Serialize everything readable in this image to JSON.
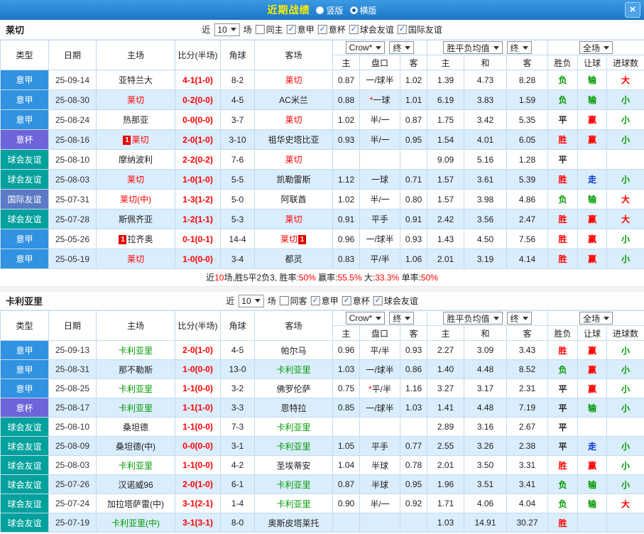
{
  "titlebar": {
    "title": "近期战绩",
    "radio_vertical": "竖版",
    "radio_horizontal": "横版",
    "close": "×"
  },
  "type_colors": {
    "意甲": "#3092e0",
    "意杯": "#6e64d9",
    "球会友谊": "#00a19d",
    "国际友谊": "#5b7ac5"
  },
  "status_colors": {
    "r": "#ff0000",
    "g": "#009900",
    "b": "#0033cc",
    "k": "#222222"
  },
  "sections": [
    {
      "team": "莱切",
      "team_color": "#ff0000",
      "filters": {
        "near_label": "近",
        "count": "10",
        "games_label": "场",
        "checkboxes": [
          {
            "label": "同主",
            "checked": false
          },
          {
            "label": "意甲",
            "checked": true
          },
          {
            "label": "意杯",
            "checked": true
          },
          {
            "label": "球会友谊",
            "checked": true
          },
          {
            "label": "国际友谊",
            "checked": true
          }
        ]
      },
      "header": {
        "type": "类型",
        "date": "日期",
        "home": "主场",
        "score": "比分(半场)",
        "corner": "角球",
        "away": "客场",
        "odds_select": "Crow*",
        "odds_final": "终",
        "avg_select": "胜平负均值",
        "avg_final": "终",
        "scope_select": "全场",
        "sub": [
          "主",
          "盘口",
          "客",
          "主",
          "和",
          "客",
          "胜负",
          "让球",
          "进球数"
        ]
      },
      "rows": [
        {
          "type": "意甲",
          "date": "25-09-14",
          "home": "亚特兰大",
          "score": "4-1(1-0)",
          "corner": "8-2",
          "away": "莱切",
          "away_hl": true,
          "odds": [
            "0.87",
            "一/球半",
            "1.02"
          ],
          "avg": [
            "1.39",
            "4.73",
            "8.28"
          ],
          "res": "负",
          "res_c": "g",
          "han": "输",
          "han_c": "g",
          "goal": "大",
          "goal_c": "r"
        },
        {
          "type": "意甲",
          "date": "25-08-30",
          "home": "莱切",
          "home_hl": true,
          "score": "0-2(0-0)",
          "corner": "4-5",
          "away": "AC米兰",
          "odds": [
            "0.88",
            "*一球",
            "1.01"
          ],
          "avg": [
            "6.19",
            "3.83",
            "1.59"
          ],
          "res": "负",
          "res_c": "g",
          "han": "输",
          "han_c": "g",
          "goal": "小",
          "goal_c": "g"
        },
        {
          "type": "意甲",
          "date": "25-08-24",
          "home": "热那亚",
          "score": "0-0(0-0)",
          "corner": "3-7",
          "away": "莱切",
          "away_hl": true,
          "odds": [
            "1.02",
            "半/一",
            "0.87"
          ],
          "avg": [
            "1.75",
            "3.42",
            "5.35"
          ],
          "res": "平",
          "res_c": "k",
          "han": "赢",
          "han_c": "r",
          "goal": "小",
          "goal_c": "g"
        },
        {
          "type": "意杯",
          "date": "25-08-16",
          "home": "莱切",
          "home_hl": true,
          "home_badge": "1",
          "score": "2-0(1-0)",
          "corner": "3-10",
          "away": "祖华史塔比亚",
          "odds": [
            "0.93",
            "半/一",
            "0.95"
          ],
          "avg": [
            "1.54",
            "4.01",
            "6.05"
          ],
          "res": "胜",
          "res_c": "r",
          "han": "赢",
          "han_c": "r",
          "goal": "小",
          "goal_c": "g"
        },
        {
          "type": "球会友谊",
          "date": "25-08-10",
          "home": "摩纳波利",
          "score": "2-2(0-2)",
          "corner": "7-6",
          "away": "莱切",
          "away_hl": true,
          "odds": [
            "",
            "",
            ""
          ],
          "avg": [
            "9.09",
            "5.16",
            "1.28"
          ],
          "res": "平",
          "res_c": "k",
          "han": "",
          "goal": ""
        },
        {
          "type": "球会友谊",
          "date": "25-08-03",
          "home": "莱切",
          "home_hl": true,
          "score": "1-0(1-0)",
          "corner": "5-5",
          "away": "凯勒雷斯",
          "odds": [
            "1.12",
            "一球",
            "0.71"
          ],
          "avg": [
            "1.57",
            "3.61",
            "5.39"
          ],
          "res": "胜",
          "res_c": "r",
          "han": "走",
          "han_c": "b",
          "goal": "小",
          "goal_c": "g"
        },
        {
          "type": "国际友谊",
          "date": "25-07-31",
          "home": "莱切(中)",
          "home_hl": true,
          "score": "1-3(1-2)",
          "corner": "5-0",
          "away": "阿联酋",
          "odds": [
            "1.02",
            "半/一",
            "0.80"
          ],
          "avg": [
            "1.57",
            "3.98",
            "4.86"
          ],
          "res": "负",
          "res_c": "g",
          "han": "输",
          "han_c": "g",
          "goal": "大",
          "goal_c": "r"
        },
        {
          "type": "球会友谊",
          "date": "25-07-28",
          "home": "斯佩齐亚",
          "score": "1-2(1-1)",
          "corner": "5-3",
          "away": "莱切",
          "away_hl": true,
          "odds": [
            "0.91",
            "平手",
            "0.91"
          ],
          "avg": [
            "2.42",
            "3.56",
            "2.47"
          ],
          "res": "胜",
          "res_c": "r",
          "han": "赢",
          "han_c": "r",
          "goal": "大",
          "goal_c": "r"
        },
        {
          "type": "意甲",
          "date": "25-05-26",
          "home": "拉齐奥",
          "home_badge": "1",
          "score": "0-1(0-1)",
          "corner": "14-4",
          "away": "莱切",
          "away_hl": true,
          "away_badge": "1",
          "odds": [
            "0.96",
            "一/球半",
            "0.93"
          ],
          "avg": [
            "1.43",
            "4.50",
            "7.56"
          ],
          "res": "胜",
          "res_c": "r",
          "han": "赢",
          "han_c": "r",
          "goal": "小",
          "goal_c": "g"
        },
        {
          "type": "意甲",
          "date": "25-05-19",
          "home": "莱切",
          "home_hl": true,
          "score": "1-0(0-0)",
          "corner": "3-4",
          "away": "都灵",
          "odds": [
            "0.83",
            "平/半",
            "1.06"
          ],
          "avg": [
            "2.01",
            "3.19",
            "4.14"
          ],
          "res": "胜",
          "res_c": "r",
          "han": "赢",
          "han_c": "r",
          "goal": "小",
          "goal_c": "g"
        }
      ],
      "summary": [
        {
          "t": "近",
          "c": "k"
        },
        {
          "t": "10",
          "c": "r"
        },
        {
          "t": "场,胜5平2负3, 胜率:",
          "c": "k"
        },
        {
          "t": "50%",
          "c": "r"
        },
        {
          "t": " 赢率:",
          "c": "k"
        },
        {
          "t": "55.5%",
          "c": "r"
        },
        {
          "t": " 大:",
          "c": "k"
        },
        {
          "t": "33.3%",
          "c": "r"
        },
        {
          "t": " 单率:",
          "c": "k"
        },
        {
          "t": "50%",
          "c": "r"
        }
      ]
    },
    {
      "team": "卡利亚里",
      "team_color": "#009900",
      "filters": {
        "near_label": "近",
        "count": "10",
        "games_label": "场",
        "checkboxes": [
          {
            "label": "同客",
            "checked": false
          },
          {
            "label": "意甲",
            "checked": true
          },
          {
            "label": "意杯",
            "checked": true
          },
          {
            "label": "球会友谊",
            "checked": true
          }
        ]
      },
      "header": {
        "type": "类型",
        "date": "日期",
        "home": "主场",
        "score": "比分(半场)",
        "corner": "角球",
        "away": "客场",
        "odds_select": "Crow*",
        "odds_final": "终",
        "avg_select": "胜平负均值",
        "avg_final": "终",
        "scope_select": "全场",
        "sub": [
          "主",
          "盘口",
          "客",
          "主",
          "和",
          "客",
          "胜负",
          "让球",
          "进球数"
        ]
      },
      "rows": [
        {
          "type": "意甲",
          "date": "25-09-13",
          "home": "卡利亚里",
          "home_hl": true,
          "score": "2-0(1-0)",
          "corner": "4-5",
          "away": "帕尔马",
          "odds": [
            "0.96",
            "平/半",
            "0.93"
          ],
          "avg": [
            "2.27",
            "3.09",
            "3.43"
          ],
          "res": "胜",
          "res_c": "r",
          "han": "赢",
          "han_c": "r",
          "goal": "小",
          "goal_c": "g"
        },
        {
          "type": "意甲",
          "date": "25-08-31",
          "home": "那不勒斯",
          "score": "1-0(0-0)",
          "corner": "13-0",
          "away": "卡利亚里",
          "away_hl": true,
          "odds": [
            "1.03",
            "一/球半",
            "0.86"
          ],
          "avg": [
            "1.40",
            "4.48",
            "8.52"
          ],
          "res": "负",
          "res_c": "g",
          "han": "赢",
          "han_c": "r",
          "goal": "小",
          "goal_c": "g"
        },
        {
          "type": "意甲",
          "date": "25-08-25",
          "home": "卡利亚里",
          "home_hl": true,
          "score": "1-1(0-0)",
          "corner": "3-2",
          "away": "佛罗伦萨",
          "odds": [
            "0.75",
            "*平/半",
            "1.16"
          ],
          "avg": [
            "3.27",
            "3.17",
            "2.31"
          ],
          "res": "平",
          "res_c": "k",
          "han": "赢",
          "han_c": "r",
          "goal": "小",
          "goal_c": "g"
        },
        {
          "type": "意杯",
          "date": "25-08-17",
          "home": "卡利亚里",
          "home_hl": true,
          "score": "1-1(1-0)",
          "corner": "3-3",
          "away": "恩特拉",
          "odds": [
            "0.85",
            "一/球半",
            "1.03"
          ],
          "avg": [
            "1.41",
            "4.48",
            "7.19"
          ],
          "res": "平",
          "res_c": "k",
          "han": "输",
          "han_c": "g",
          "goal": "小",
          "goal_c": "g"
        },
        {
          "type": "球会友谊",
          "date": "25-08-10",
          "home": "桑坦德",
          "score": "1-1(0-0)",
          "corner": "7-3",
          "away": "卡利亚里",
          "away_hl": true,
          "odds": [
            "",
            "",
            ""
          ],
          "avg": [
            "2.89",
            "3.16",
            "2.67"
          ],
          "res": "平",
          "res_c": "k",
          "han": "",
          "goal": ""
        },
        {
          "type": "球会友谊",
          "date": "25-08-09",
          "home": "桑坦德(中)",
          "score": "0-0(0-0)",
          "corner": "3-1",
          "away": "卡利亚里",
          "away_hl": true,
          "odds": [
            "1.05",
            "平手",
            "0.77"
          ],
          "avg": [
            "2.55",
            "3.26",
            "2.38"
          ],
          "res": "平",
          "res_c": "k",
          "han": "走",
          "han_c": "b",
          "goal": "小",
          "goal_c": "g"
        },
        {
          "type": "球会友谊",
          "date": "25-08-03",
          "home": "卡利亚里",
          "home_hl": true,
          "score": "1-1(0-0)",
          "corner": "4-2",
          "away": "圣埃蒂安",
          "odds": [
            "1.04",
            "半球",
            "0.78"
          ],
          "avg": [
            "2.01",
            "3.50",
            "3.31"
          ],
          "res": "胜",
          "res_c": "r",
          "han": "赢",
          "han_c": "r",
          "goal": "小",
          "goal_c": "g"
        },
        {
          "type": "球会友谊",
          "date": "25-07-26",
          "home": "汉诺威96",
          "score": "2-0(1-0)",
          "corner": "6-1",
          "away": "卡利亚里",
          "away_hl": true,
          "odds": [
            "0.87",
            "半球",
            "0.95"
          ],
          "avg": [
            "1.96",
            "3.51",
            "3.41"
          ],
          "res": "负",
          "res_c": "g",
          "han": "输",
          "han_c": "g",
          "goal": "小",
          "goal_c": "g"
        },
        {
          "type": "球会友谊",
          "date": "25-07-24",
          "home": "加拉塔萨雷(中)",
          "score": "3-1(2-1)",
          "corner": "1-4",
          "away": "卡利亚里",
          "away_hl": true,
          "odds": [
            "0.90",
            "半/一",
            "0.92"
          ],
          "avg": [
            "1.71",
            "4.06",
            "4.04"
          ],
          "res": "负",
          "res_c": "g",
          "han": "输",
          "han_c": "g",
          "goal": "大",
          "goal_c": "r"
        },
        {
          "type": "球会友谊",
          "date": "25-07-19",
          "home": "卡利亚里(中)",
          "home_hl": true,
          "score": "3-1(3-1)",
          "corner": "8-0",
          "away": "奥斯皮塔莱托",
          "odds": [
            "",
            "",
            ""
          ],
          "avg": [
            "1.03",
            "14.91",
            "30.27"
          ],
          "res": "胜",
          "res_c": "r",
          "han": "",
          "goal": ""
        }
      ]
    }
  ]
}
